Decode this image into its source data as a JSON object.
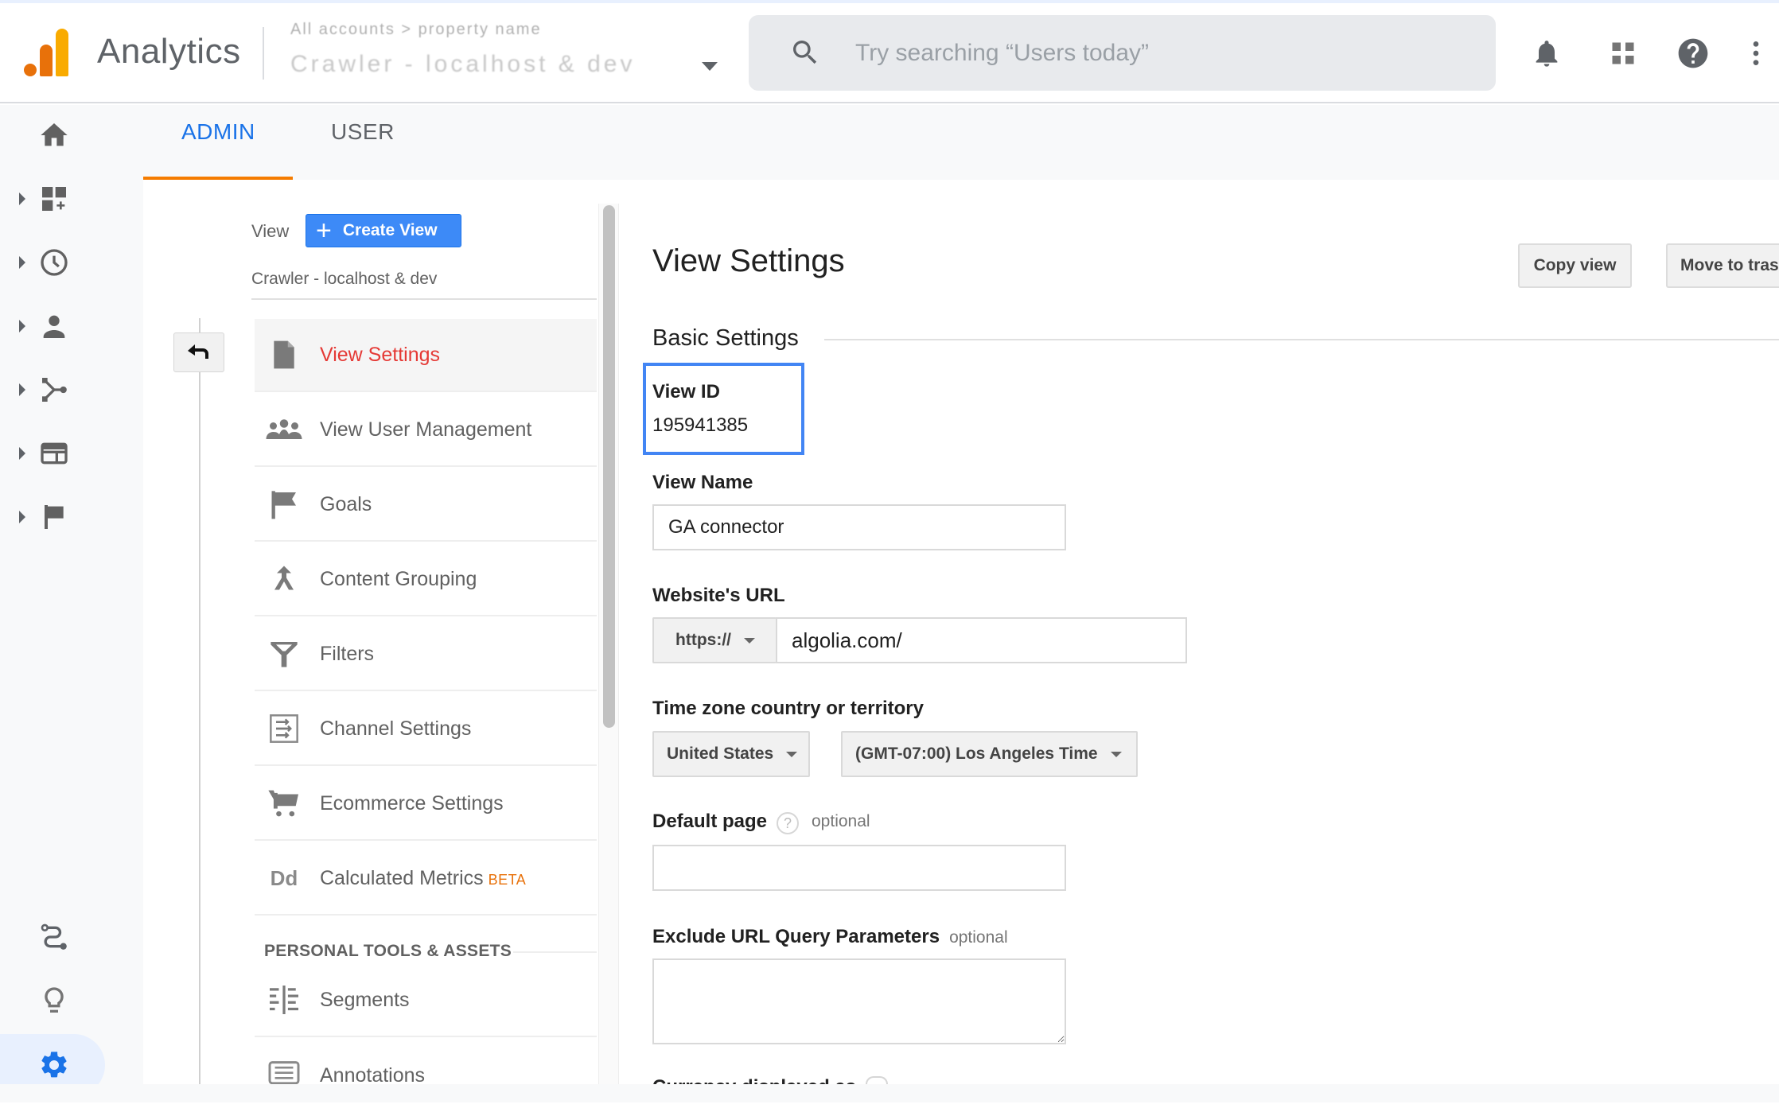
{
  "header": {
    "app_title": "Analytics",
    "account_selector": {
      "line1": "All accounts > property name",
      "line2": "Crawler - localhost & dev"
    },
    "search": {
      "placeholder": "Try searching “Users today”",
      "value": ""
    },
    "icons": [
      "notifications-icon",
      "apps-icon",
      "help-icon",
      "more-vert-icon"
    ]
  },
  "rail": {
    "items": [
      "home",
      "customization",
      "realtime",
      "audience",
      "acquisition",
      "behavior",
      "conversions",
      "attribution",
      "discover",
      "admin"
    ],
    "active": "admin"
  },
  "tabs": [
    {
      "label": "ADMIN",
      "active": true
    },
    {
      "label": "USER",
      "active": false
    }
  ],
  "nav": {
    "view_label": "View",
    "create_view_label": "Create View",
    "current_view": "Crawler - localhost & dev",
    "items": [
      {
        "label": "View Settings",
        "icon": "document-icon",
        "selected": true
      },
      {
        "label": "View User Management",
        "icon": "people-icon",
        "selected": false
      },
      {
        "label": "Goals",
        "icon": "flag-icon",
        "selected": false
      },
      {
        "label": "Content Grouping",
        "icon": "merge-icon",
        "selected": false
      },
      {
        "label": "Filters",
        "icon": "filter-icon",
        "selected": false
      },
      {
        "label": "Channel Settings",
        "icon": "channel-icon",
        "selected": false
      },
      {
        "label": "Ecommerce Settings",
        "icon": "cart-icon",
        "selected": false
      },
      {
        "label": "Calculated Metrics",
        "badge": "BETA",
        "icon": "calculated-metrics-icon",
        "selected": false
      }
    ],
    "personal_header": "PERSONAL TOOLS & ASSETS",
    "personal_items": [
      {
        "label": "Segments",
        "icon": "segments-icon"
      },
      {
        "label": "Annotations",
        "icon": "annotations-icon"
      }
    ]
  },
  "main": {
    "title": "View Settings",
    "copy_view_label": "Copy view",
    "move_to_trash_label": "Move to trash",
    "section_title": "Basic Settings",
    "view_id": {
      "label": "View ID",
      "value": "195941385"
    },
    "view_name": {
      "label": "View Name",
      "value": "GA connector"
    },
    "website_url": {
      "label": "Website's URL",
      "protocol": "https://",
      "value": "algolia.com/"
    },
    "time_zone": {
      "label": "Time zone country or territory",
      "country": "United States",
      "zone": "(GMT-07:00) Los Angeles Time"
    },
    "default_page": {
      "label": "Default page",
      "optional": "optional",
      "value": ""
    },
    "exclude_params": {
      "label": "Exclude URL Query Parameters",
      "optional": "optional",
      "value": ""
    },
    "next_label": "Currency displayed as"
  },
  "colors": {
    "accent_blue": "#1a73e8",
    "tab_underline": "#f57c00",
    "selected_nav": "#e53935",
    "highlight_box": "#4285f4",
    "beta": "#e8710a",
    "logo_orange": "#e8710a",
    "logo_yellow": "#f9ab00"
  }
}
